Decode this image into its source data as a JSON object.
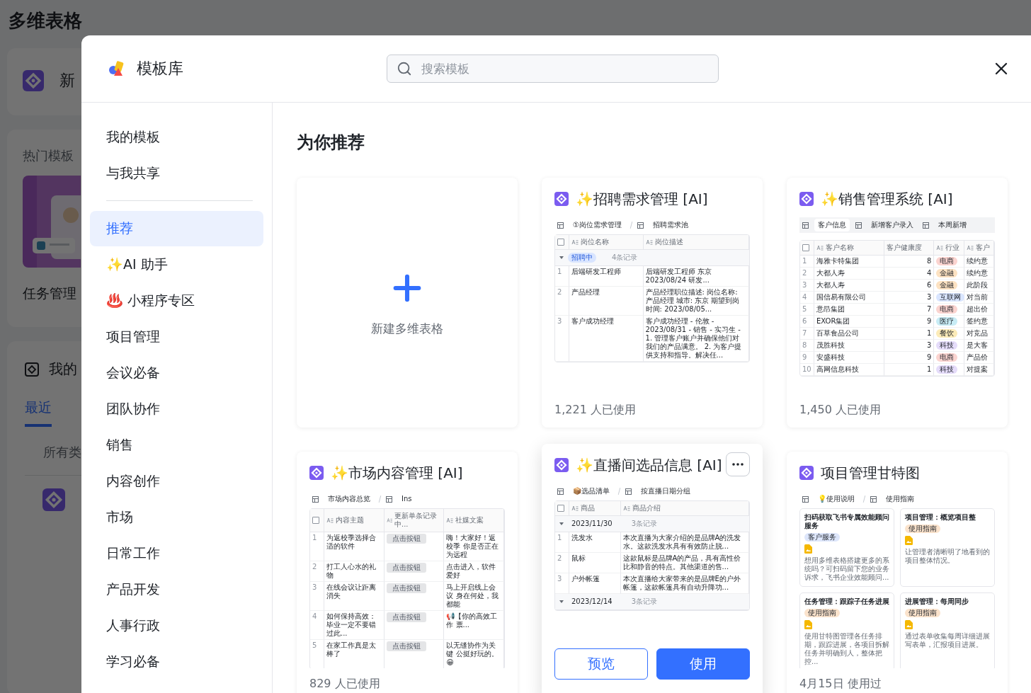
{
  "background_page": {
    "title": "多维表格",
    "new_label": "新",
    "hot_heading": "热门模板",
    "hot_name": "任务管理",
    "my_heading": "我的",
    "my_tabs": [
      {
        "label": "最近",
        "selected": true
      }
    ],
    "filter": "所有类"
  },
  "modal": {
    "title": "模板库",
    "search": {
      "placeholder": "搜索模板"
    },
    "sidebar": {
      "personal": [
        {
          "label": "我的模板",
          "selected": false
        },
        {
          "label": "与我共享",
          "selected": false
        }
      ],
      "categories": [
        {
          "label": "推荐",
          "selected": true
        },
        {
          "label": "✨AI 助手",
          "selected": false
        },
        {
          "label": "♨️ 小程序专区",
          "selected": false
        },
        {
          "label": "项目管理",
          "selected": false
        },
        {
          "label": "会议必备",
          "selected": false
        },
        {
          "label": "团队协作",
          "selected": false
        },
        {
          "label": "销售",
          "selected": false
        },
        {
          "label": "内容创作",
          "selected": false
        },
        {
          "label": "市场",
          "selected": false
        },
        {
          "label": "日常工作",
          "selected": false
        },
        {
          "label": "产品开发",
          "selected": false
        },
        {
          "label": "人事行政",
          "selected": false
        },
        {
          "label": "学习必备",
          "selected": false
        }
      ]
    },
    "section_title": "为你推荐",
    "cards": [
      {
        "kind": "new",
        "label": "新建多维表格"
      },
      {
        "kind": "template",
        "title": "✨招聘需求管理 [AI]",
        "hovered": false,
        "footer": "1,221 人已使用",
        "thumbnail": {
          "kind": "table",
          "all_checked": false,
          "views": [
            {
              "label": "①岗位需求管理"
            },
            {
              "label": "招聘需求池"
            }
          ],
          "columns": [
            {
              "label": "岗位名称",
              "kind": "text"
            },
            {
              "label": "岗位描述",
              "kind": "text"
            }
          ],
          "groups": [
            {
              "label": "招聘中",
              "count": "4条记录",
              "color": "#d9e5ff",
              "rows": [
                {
                  "no": "1",
                  "cells": [
                    "后端研发工程师",
                    "后端研发工程师 东京 2023/08/24 研发..."
                  ]
                },
                {
                  "no": "2",
                  "cells": [
                    "产品经理",
                    "产品经理职位描述: 岗位名称: 产品经理 城市: 东京 期望到岗时间: 2023/08/05..."
                  ]
                },
                {
                  "no": "3",
                  "cells": [
                    "客户成功经理",
                    "客户成功经理 - 伦敦 - 2023/08/31 - 销售 - 实习生 - 1. 管理客户账户并确保他们对我们的产品满意。 2. 为客户提供支持和指导。解决任..."
                  ]
                }
              ]
            }
          ]
        }
      },
      {
        "kind": "template",
        "title": "✨销售管理系统 [AI]",
        "hovered": false,
        "footer": "1,450 人已使用",
        "thumbnail": {
          "kind": "table",
          "all_checked": false,
          "views": [
            {
              "label": "客户信息",
              "selected": true
            },
            {
              "label": "新增客户录入",
              "selected": false
            },
            {
              "label": "本周新增",
              "selected": false
            }
          ],
          "columns": [
            {
              "label": "客户名称",
              "kind": "text"
            },
            {
              "label": "客户健康度",
              "kind": "number"
            },
            {
              "label": "行业",
              "kind": "tag"
            },
            {
              "label": "客户",
              "kind": "text"
            }
          ],
          "rows": [
            {
              "no": "1",
              "cells": [
                "海雅卡特集团",
                "8",
                {
                  "text": "电商",
                  "color": "#fbd4d0"
                },
                "续约意"
              ]
            },
            {
              "no": "2",
              "cells": [
                "大都人寿",
                "4",
                {
                  "text": "金融",
                  "color": "#fde2c2"
                },
                "续约意"
              ]
            },
            {
              "no": "3",
              "cells": [
                "大都人寿",
                "6",
                {
                  "text": "金融",
                  "color": "#fde2c2"
                },
                "此阶段"
              ]
            },
            {
              "no": "4",
              "cells": [
                "国信易有限公司",
                "3",
                {
                  "text": "互联网",
                  "color": "#d9e5ff"
                },
                "对当前"
              ]
            },
            {
              "no": "5",
              "cells": [
                "意昂集团",
                "7",
                {
                  "text": "电商",
                  "color": "#fbd4d0"
                },
                "超出价"
              ]
            },
            {
              "no": "6",
              "cells": [
                "EXOR集团",
                "9",
                {
                  "text": "医疗",
                  "color": "#c8ecf5"
                },
                "签约意"
              ]
            },
            {
              "no": "7",
              "cells": [
                "百草食品公司",
                "1",
                {
                  "text": "餐饮",
                  "color": "#fcebb8"
                },
                "对竞品"
              ]
            },
            {
              "no": "8",
              "cells": [
                "茂胜科技",
                "3",
                {
                  "text": "科技",
                  "color": "#e5dcfa"
                },
                "是大客"
              ]
            },
            {
              "no": "9",
              "cells": [
                "安盛科技",
                "9",
                {
                  "text": "电商",
                  "color": "#fbd4d0"
                },
                "产品价"
              ]
            },
            {
              "no": "10",
              "cells": [
                "高网信息科技",
                "1",
                {
                  "text": "科技",
                  "color": "#e5dcfa"
                },
                "对提案"
              ]
            }
          ]
        }
      },
      {
        "kind": "template",
        "title": "✨市场内容管理 [AI]",
        "hovered": false,
        "footer": "829 人已使用",
        "thumbnail": {
          "kind": "table",
          "all_checked": false,
          "views": [
            {
              "label": "市场内容总览"
            },
            {
              "label": "Ins"
            }
          ],
          "columns": [
            {
              "label": "内容主题",
              "kind": "text"
            },
            {
              "label": "更新单条记录中...",
              "kind": "button"
            },
            {
              "label": "社媒文案",
              "kind": "text"
            }
          ],
          "rows": [
            {
              "no": "1",
              "cells": [
                "为返校季选择合适的软件",
                "点击按钮",
                "嗨！大家好！返校季 你是否正在为远程"
              ]
            },
            {
              "no": "2",
              "cells": [
                "打工人心水的礼物",
                "点击按钮",
                "点击进入，软件爱好"
              ]
            },
            {
              "no": "3",
              "cells": [
                "在线会议让距离消失",
                "点击按钮",
                "马上开启线上会议 身在何处，我都能"
              ]
            },
            {
              "no": "4",
              "cells": [
                "如何保持高效：毕业一定不要错过此...",
                "点击按钮",
                "📢【你的高效工作 票..."
              ]
            },
            {
              "no": "5",
              "cells": [
                "在家工作真是太棒了",
                "点击按钮",
                "以无缝协作为关键 公挺好玩的。😀"
              ]
            }
          ]
        }
      },
      {
        "kind": "template",
        "title": "✨直播间选品信息 [AI]",
        "hovered": true,
        "actions": [
          {
            "label": "预览",
            "primary": false
          },
          {
            "label": "使用",
            "primary": true
          }
        ],
        "thumbnail": {
          "kind": "table",
          "all_checked": false,
          "views": [
            {
              "label": "📦选品清单"
            },
            {
              "label": "按直播日期分组"
            }
          ],
          "columns": [
            {
              "label": "商品",
              "kind": "text"
            },
            {
              "label": "商品介绍",
              "kind": "text"
            }
          ],
          "groups": [
            {
              "label": "2023/11/30",
              "count": "3条记录",
              "rows": [
                {
                  "no": "1",
                  "cells": [
                    "洗发水",
                    "本次直播为大家介绍的是品牌A的洗发水。这款洗发水具有有效防止脱..."
                  ]
                },
                {
                  "no": "2",
                  "cells": [
                    "鼠标",
                    "这款鼠标是品牌A的产品，具有高性价比和静音的特点。其他渠道的售..."
                  ]
                },
                {
                  "no": "3",
                  "cells": [
                    "户外帐篷",
                    "本次直播给大家带来的是品牌E的户外帐篷，这款帐篷具有自动升降功..."
                  ]
                }
              ]
            },
            {
              "label": "2023/12/14",
              "count": "3条记录"
            }
          ]
        }
      },
      {
        "kind": "template",
        "title": "项目管理甘特图",
        "hovered": false,
        "footer": "4月15日 使用过",
        "thumbnail": {
          "kind": "cards",
          "views": [
            {
              "label": "💡使用说明"
            },
            {
              "label": "使用指南"
            }
          ],
          "cards": [
            {
              "title": "扫码获取飞书专属效能顾问服务",
              "tag": "客户服务",
              "color": "#dde6fb",
              "text": "想用多维表格搭建更多的系统吗？可扫码留下您的业务诉求，飞书企业效能顾问..."
            },
            {
              "title": "项目管理：概览项目整",
              "tag": "使用指南",
              "color": "#fbe3cc",
              "text": "让管理者清晰明了地看到的项目整体情况。"
            },
            {
              "title": "任务管理：跟踪子任务进展",
              "tag": "使用指南",
              "color": "#fbe3cc",
              "text": "使用甘特图管理各任务排期，跟踪进展，各项目拆解任务并明确到人，整体把控..."
            },
            {
              "title": "进展管理：每周同步",
              "tag": "使用指南",
              "color": "#fbe3cc",
              "text": "通过表单收集每周详细进展写表单，汇报项目进展。"
            }
          ]
        }
      }
    ]
  }
}
